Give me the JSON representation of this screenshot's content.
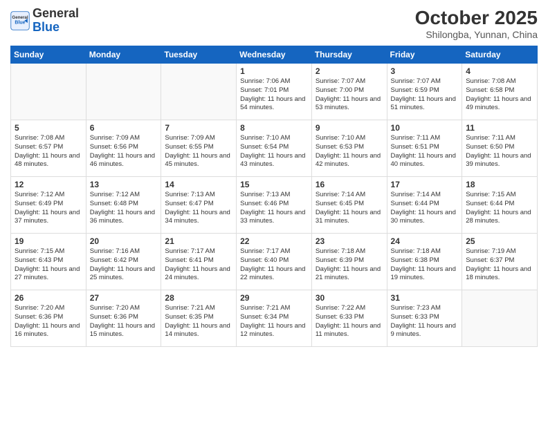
{
  "header": {
    "logo_general": "General",
    "logo_blue": "Blue",
    "month": "October 2025",
    "location": "Shilongba, Yunnan, China"
  },
  "weekdays": [
    "Sunday",
    "Monday",
    "Tuesday",
    "Wednesday",
    "Thursday",
    "Friday",
    "Saturday"
  ],
  "weeks": [
    [
      {
        "day": "",
        "info": ""
      },
      {
        "day": "",
        "info": ""
      },
      {
        "day": "",
        "info": ""
      },
      {
        "day": "1",
        "info": "Sunrise: 7:06 AM\nSunset: 7:01 PM\nDaylight: 11 hours\nand 54 minutes."
      },
      {
        "day": "2",
        "info": "Sunrise: 7:07 AM\nSunset: 7:00 PM\nDaylight: 11 hours\nand 53 minutes."
      },
      {
        "day": "3",
        "info": "Sunrise: 7:07 AM\nSunset: 6:59 PM\nDaylight: 11 hours\nand 51 minutes."
      },
      {
        "day": "4",
        "info": "Sunrise: 7:08 AM\nSunset: 6:58 PM\nDaylight: 11 hours\nand 49 minutes."
      }
    ],
    [
      {
        "day": "5",
        "info": "Sunrise: 7:08 AM\nSunset: 6:57 PM\nDaylight: 11 hours\nand 48 minutes."
      },
      {
        "day": "6",
        "info": "Sunrise: 7:09 AM\nSunset: 6:56 PM\nDaylight: 11 hours\nand 46 minutes."
      },
      {
        "day": "7",
        "info": "Sunrise: 7:09 AM\nSunset: 6:55 PM\nDaylight: 11 hours\nand 45 minutes."
      },
      {
        "day": "8",
        "info": "Sunrise: 7:10 AM\nSunset: 6:54 PM\nDaylight: 11 hours\nand 43 minutes."
      },
      {
        "day": "9",
        "info": "Sunrise: 7:10 AM\nSunset: 6:53 PM\nDaylight: 11 hours\nand 42 minutes."
      },
      {
        "day": "10",
        "info": "Sunrise: 7:11 AM\nSunset: 6:51 PM\nDaylight: 11 hours\nand 40 minutes."
      },
      {
        "day": "11",
        "info": "Sunrise: 7:11 AM\nSunset: 6:50 PM\nDaylight: 11 hours\nand 39 minutes."
      }
    ],
    [
      {
        "day": "12",
        "info": "Sunrise: 7:12 AM\nSunset: 6:49 PM\nDaylight: 11 hours\nand 37 minutes."
      },
      {
        "day": "13",
        "info": "Sunrise: 7:12 AM\nSunset: 6:48 PM\nDaylight: 11 hours\nand 36 minutes."
      },
      {
        "day": "14",
        "info": "Sunrise: 7:13 AM\nSunset: 6:47 PM\nDaylight: 11 hours\nand 34 minutes."
      },
      {
        "day": "15",
        "info": "Sunrise: 7:13 AM\nSunset: 6:46 PM\nDaylight: 11 hours\nand 33 minutes."
      },
      {
        "day": "16",
        "info": "Sunrise: 7:14 AM\nSunset: 6:45 PM\nDaylight: 11 hours\nand 31 minutes."
      },
      {
        "day": "17",
        "info": "Sunrise: 7:14 AM\nSunset: 6:44 PM\nDaylight: 11 hours\nand 30 minutes."
      },
      {
        "day": "18",
        "info": "Sunrise: 7:15 AM\nSunset: 6:44 PM\nDaylight: 11 hours\nand 28 minutes."
      }
    ],
    [
      {
        "day": "19",
        "info": "Sunrise: 7:15 AM\nSunset: 6:43 PM\nDaylight: 11 hours\nand 27 minutes."
      },
      {
        "day": "20",
        "info": "Sunrise: 7:16 AM\nSunset: 6:42 PM\nDaylight: 11 hours\nand 25 minutes."
      },
      {
        "day": "21",
        "info": "Sunrise: 7:17 AM\nSunset: 6:41 PM\nDaylight: 11 hours\nand 24 minutes."
      },
      {
        "day": "22",
        "info": "Sunrise: 7:17 AM\nSunset: 6:40 PM\nDaylight: 11 hours\nand 22 minutes."
      },
      {
        "day": "23",
        "info": "Sunrise: 7:18 AM\nSunset: 6:39 PM\nDaylight: 11 hours\nand 21 minutes."
      },
      {
        "day": "24",
        "info": "Sunrise: 7:18 AM\nSunset: 6:38 PM\nDaylight: 11 hours\nand 19 minutes."
      },
      {
        "day": "25",
        "info": "Sunrise: 7:19 AM\nSunset: 6:37 PM\nDaylight: 11 hours\nand 18 minutes."
      }
    ],
    [
      {
        "day": "26",
        "info": "Sunrise: 7:20 AM\nSunset: 6:36 PM\nDaylight: 11 hours\nand 16 minutes."
      },
      {
        "day": "27",
        "info": "Sunrise: 7:20 AM\nSunset: 6:36 PM\nDaylight: 11 hours\nand 15 minutes."
      },
      {
        "day": "28",
        "info": "Sunrise: 7:21 AM\nSunset: 6:35 PM\nDaylight: 11 hours\nand 14 minutes."
      },
      {
        "day": "29",
        "info": "Sunrise: 7:21 AM\nSunset: 6:34 PM\nDaylight: 11 hours\nand 12 minutes."
      },
      {
        "day": "30",
        "info": "Sunrise: 7:22 AM\nSunset: 6:33 PM\nDaylight: 11 hours\nand 11 minutes."
      },
      {
        "day": "31",
        "info": "Sunrise: 7:23 AM\nSunset: 6:33 PM\nDaylight: 11 hours\nand 9 minutes."
      },
      {
        "day": "",
        "info": ""
      }
    ]
  ]
}
